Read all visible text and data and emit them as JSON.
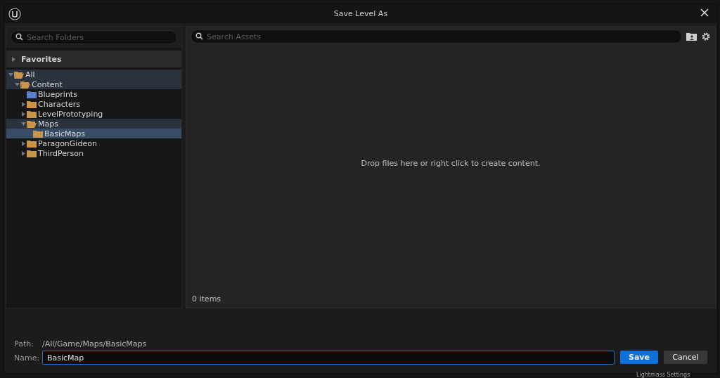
{
  "window": {
    "title": "Save Level As"
  },
  "folder_search": {
    "placeholder": "Search Folders"
  },
  "favorites": {
    "label": "Favorites",
    "expanded": false
  },
  "tree": [
    {
      "label": "All",
      "expanded": true,
      "selected": false,
      "highlighted": true,
      "color": "#c8954a",
      "children": [
        {
          "label": "Content",
          "expanded": true,
          "selected": false,
          "highlighted": true,
          "color": "#c8954a",
          "children": [
            {
              "label": "Blueprints",
              "selected": false,
              "highlighted": false,
              "color": "#5c7fc9"
            },
            {
              "label": "Characters",
              "expanded": false,
              "selected": false,
              "highlighted": false,
              "color": "#c8954a"
            },
            {
              "label": "LevelPrototyping",
              "expanded": false,
              "selected": false,
              "highlighted": false,
              "color": "#c8954a"
            },
            {
              "label": "Maps",
              "expanded": true,
              "selected": false,
              "highlighted": true,
              "color": "#c8954a",
              "children": [
                {
                  "label": "BasicMaps",
                  "selected": true,
                  "color": "#c8954a"
                }
              ]
            },
            {
              "label": "ParagonGideon",
              "expanded": false,
              "selected": false,
              "highlighted": false,
              "color": "#c8954a"
            },
            {
              "label": "ThirdPerson",
              "expanded": false,
              "selected": false,
              "highlighted": false,
              "color": "#c8954a"
            }
          ]
        }
      ]
    }
  ],
  "asset_search": {
    "placeholder": "Search Assets"
  },
  "empty_message": "Drop files here or right click to create content.",
  "item_count": "0 items",
  "path": {
    "label": "Path:",
    "value": "/All/Game/Maps/BasicMaps"
  },
  "name": {
    "label": "Name:",
    "value": "BasicMap"
  },
  "buttons": [
    {
      "label": "Save",
      "kind": "primary"
    },
    {
      "label": "Cancel",
      "kind": "secondary"
    }
  ],
  "background": {
    "panel_label": "Lightmass Settings"
  }
}
